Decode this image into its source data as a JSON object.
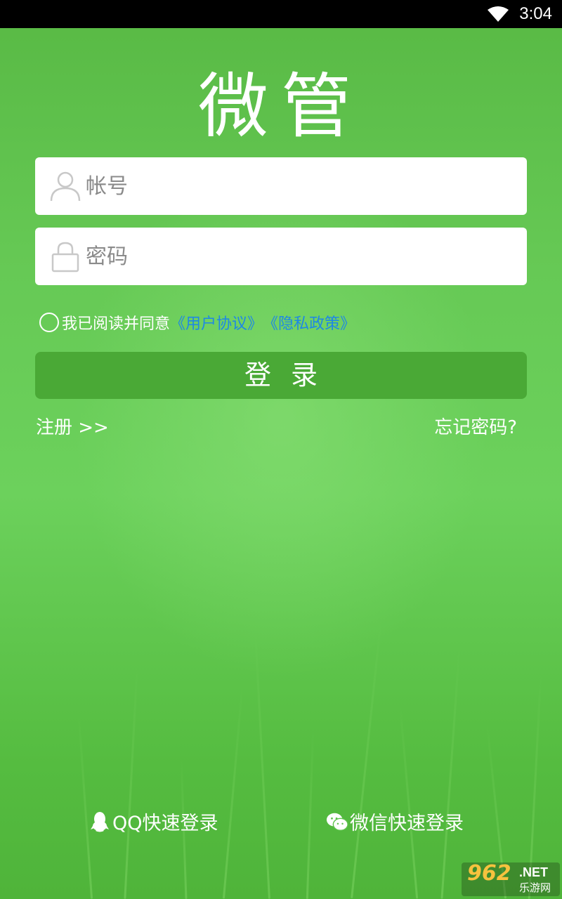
{
  "status_bar": {
    "time": "3:04"
  },
  "app": {
    "title": "微管"
  },
  "form": {
    "account_placeholder": "帐号",
    "password_placeholder": "密码"
  },
  "agreement": {
    "text": "我已阅读并同意",
    "user_agreement": "《用户协议》",
    "privacy_policy": "《隐私政策》",
    "link_color": "#1e88e5"
  },
  "login_button": "登录",
  "register_link": "注册 >>",
  "forgot_link": "忘记密码?",
  "quick_login": {
    "qq": "QQ快速登录",
    "wechat": "微信快速登录"
  },
  "watermark": {
    "number": "962",
    "net": ".NET",
    "name": "乐游网"
  },
  "colors": {
    "background": "#5ec24c",
    "button": "#4aa936",
    "field": "#ffffff"
  }
}
